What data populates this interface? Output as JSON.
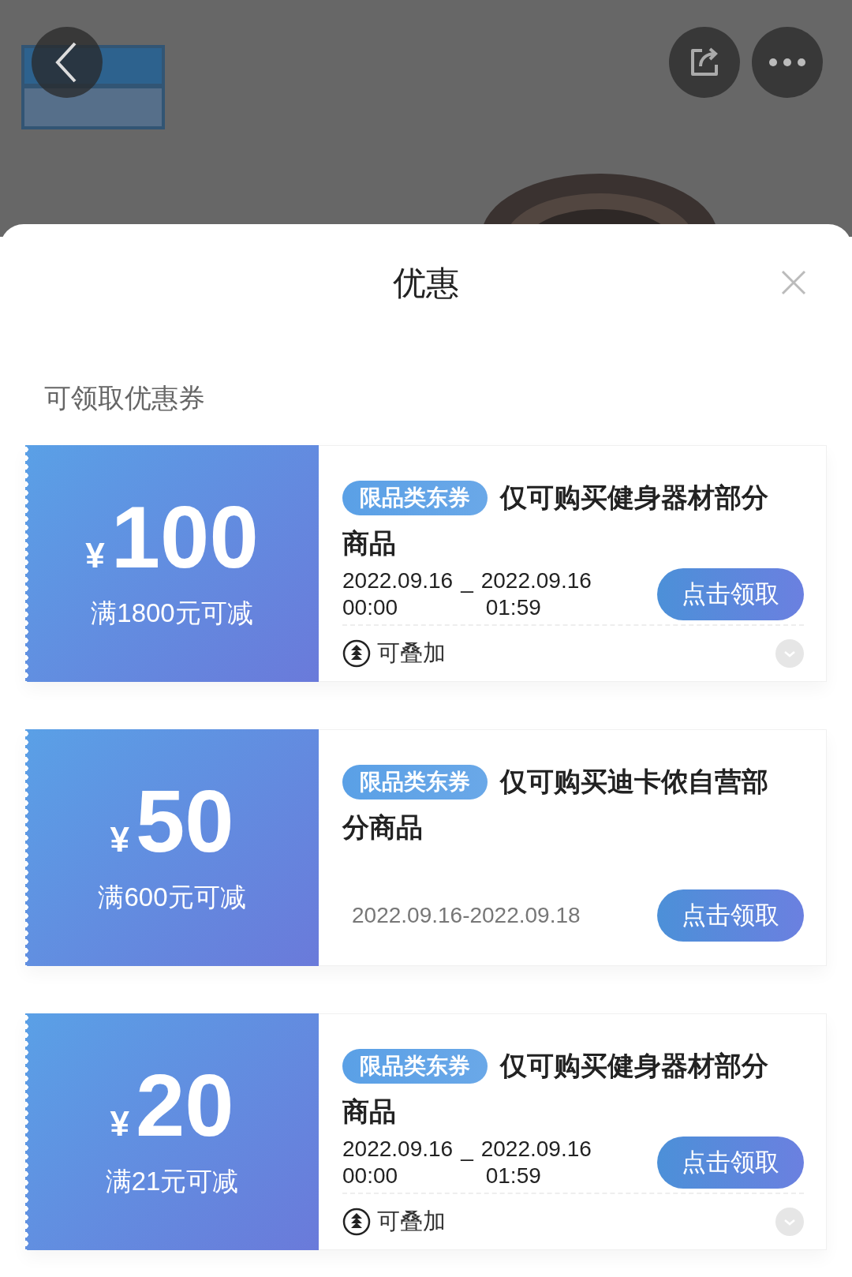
{
  "sheet": {
    "title": "优惠",
    "section_title": "可领取优惠券"
  },
  "coupons": [
    {
      "kind": "detailed",
      "currency": "¥",
      "amount": "100",
      "condition": "满1800元可减",
      "tag": "限品类东券",
      "title": "仅可购买健身器材部分商品",
      "start_date": "2022.09.16",
      "separator": "_",
      "end_date": "2022.09.16",
      "start_time": "00:00",
      "end_time": "01:59",
      "button": "点击领取",
      "stack_label": "可叠加"
    },
    {
      "kind": "simple",
      "currency": "¥",
      "amount": "50",
      "condition": "满600元可减",
      "tag": "限品类东券",
      "title": "仅可购买迪卡侬自营部分商品",
      "date_range": "2022.09.16-2022.09.18",
      "button": "点击领取"
    },
    {
      "kind": "detailed",
      "currency": "¥",
      "amount": "20",
      "condition": "满21元可减",
      "tag": "限品类东券",
      "title": "仅可购买健身器材部分商品",
      "start_date": "2022.09.16",
      "separator": "_",
      "end_date": "2022.09.16",
      "start_time": "00:00",
      "end_time": "01:59",
      "button": "点击领取",
      "stack_label": "可叠加"
    }
  ]
}
